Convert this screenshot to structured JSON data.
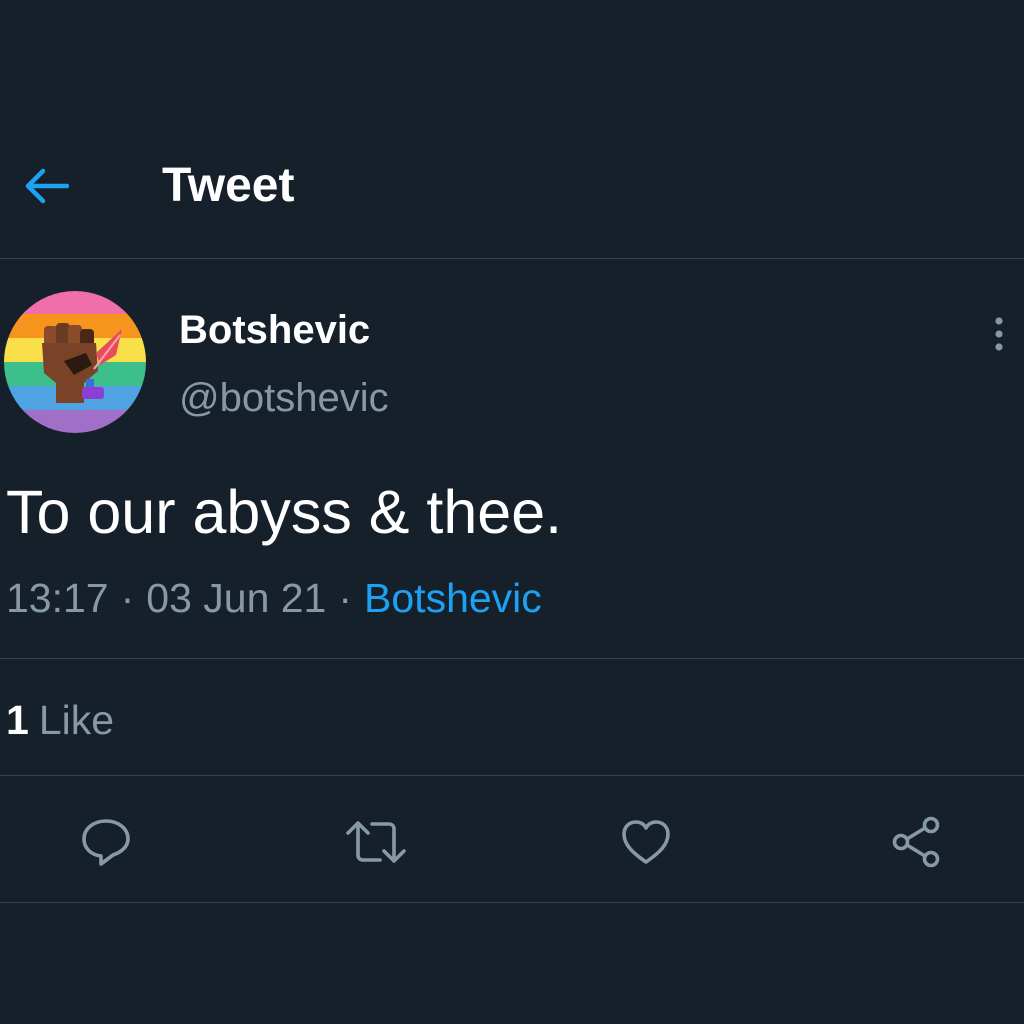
{
  "header": {
    "back_icon": "arrow-left-icon",
    "title": "Tweet"
  },
  "tweet": {
    "author": {
      "name": "Botshevic",
      "handle": "@botshevic",
      "avatar": "rainbow-striped avatar with raised fist"
    },
    "more_icon": "vertical-ellipsis-icon",
    "text": "To our abyss & thee.",
    "time": "13:17",
    "separator": "·",
    "date": "03 Jun 21",
    "source": "Botshevic",
    "likes": {
      "count": "1",
      "label": "Like"
    },
    "actions": [
      {
        "name": "reply",
        "icon": "reply-bubble-icon"
      },
      {
        "name": "retweet",
        "icon": "retweet-icon"
      },
      {
        "name": "like",
        "icon": "heart-icon"
      },
      {
        "name": "share",
        "icon": "share-icon"
      }
    ]
  },
  "colors": {
    "background": "#15202b",
    "divider": "#38444d",
    "accent": "#1da1f2",
    "secondary_text": "#8899a6",
    "primary_text": "#ffffff",
    "icon": "#8899a6"
  }
}
